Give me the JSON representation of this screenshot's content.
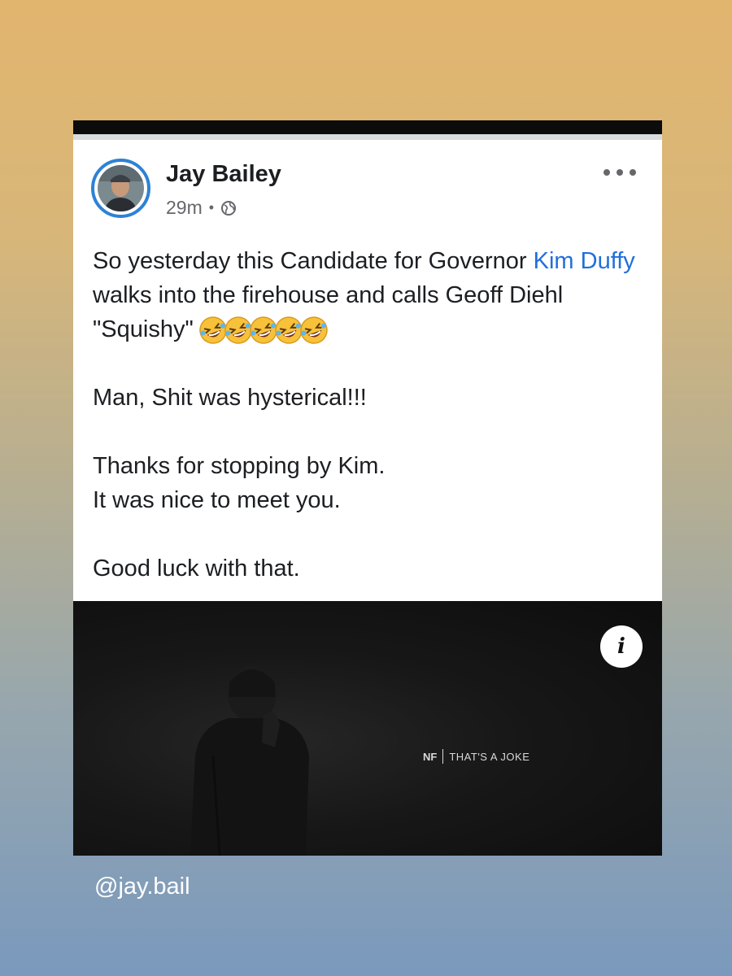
{
  "post": {
    "author": "Jay Bailey",
    "time": "29m",
    "separator": "•",
    "privacy_icon": "globe-icon",
    "menu_icon": "more-horizontal-icon",
    "text": {
      "l1_a": "So yesterday this Candidate for Governor ",
      "mention": "Kim Duffy",
      "l1_b": " walks into the firehouse and calls Geoff Diehl \"Squishy\"",
      "emoji": "rolling-on-floor-laughing-emoji",
      "emoji_count": 5,
      "p2": "Man, Shit was hysterical!!!",
      "p3_l1": "Thanks for stopping by Kim.",
      "p3_l2": "It was nice to meet you.",
      "p4": "Good luck with that."
    },
    "media": {
      "info_icon": "info-icon",
      "info_label": "i",
      "brand": "NF",
      "title": "THAT'S A JOKE"
    }
  },
  "watermark": "@jay.bail",
  "colors": {
    "link": "#216fdb",
    "avatar_ring": "#2d82d6"
  }
}
